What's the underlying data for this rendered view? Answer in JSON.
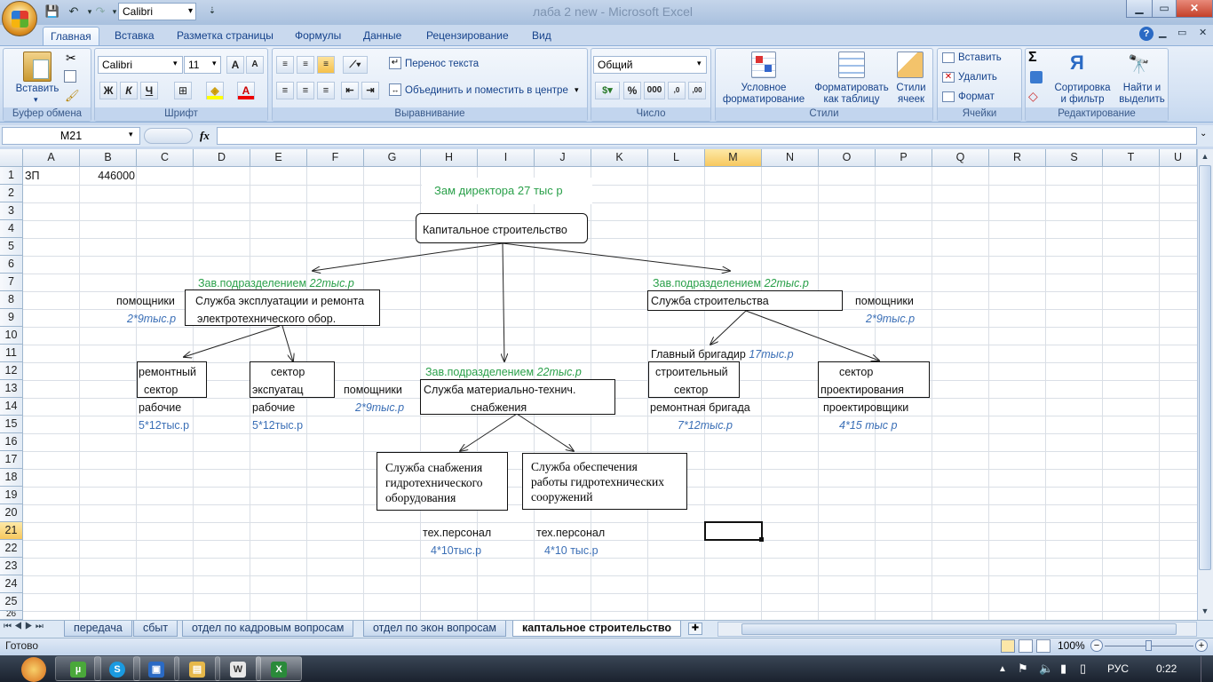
{
  "window": {
    "title": "лаба 2 new  -  Microsoft Excel"
  },
  "quick_access": {
    "font": "Calibri"
  },
  "ribbon_tabs": [
    "Главная",
    "Вставка",
    "Разметка страницы",
    "Формулы",
    "Данные",
    "Рецензирование",
    "Вид"
  ],
  "ribbon": {
    "clipboard": {
      "label": "Буфер обмена",
      "paste": "Вставить"
    },
    "font": {
      "label": "Шрифт",
      "name": "Calibri",
      "size": "11",
      "bold": "Ж",
      "italic": "К",
      "underline": "Ч"
    },
    "alignment": {
      "label": "Выравнивание",
      "wrap": "Перенос текста",
      "merge": "Объединить и поместить в центре"
    },
    "number": {
      "label": "Число",
      "format": "Общий",
      "percent": "%",
      "thousands": "000"
    },
    "styles": {
      "label": "Стили",
      "conditional": "Условное",
      "conditional2": "форматирование",
      "as_table": "Форматировать",
      "as_table2": "как таблицу",
      "cell_styles": "Стили",
      "cell_styles2": "ячеек"
    },
    "cells": {
      "label": "Ячейки",
      "insert": "Вставить",
      "delete": "Удалить",
      "format": "Формат"
    },
    "editing": {
      "label": "Редактирование",
      "sort": "Сортировка",
      "sort2": "и фильтр",
      "find": "Найти и",
      "find2": "выделить"
    }
  },
  "formula_bar": {
    "name_box": "M21",
    "fx": "fx",
    "value": ""
  },
  "columns": [
    "A",
    "B",
    "C",
    "D",
    "E",
    "F",
    "G",
    "H",
    "I",
    "J",
    "K",
    "L",
    "M",
    "N",
    "O",
    "P",
    "Q",
    "R",
    "S",
    "T",
    "U"
  ],
  "rows": [
    "1",
    "2",
    "3",
    "4",
    "5",
    "6",
    "7",
    "8",
    "9",
    "10",
    "11",
    "12",
    "13",
    "14",
    "15",
    "16",
    "17",
    "18",
    "19",
    "20",
    "21",
    "22",
    "23",
    "24",
    "25",
    "26"
  ],
  "cells": {
    "a1": "ЗП",
    "b1": "446000",
    "deputy": "Зам директора  27 тыс р",
    "capital": "Капитальное строительство",
    "head_left": "Зав.подразделением",
    "head_left_val": "22тыс.р",
    "head_right": "Зав.подразделением",
    "head_right_val": "22тыс.р",
    "head_mid": "Зав.подразделением",
    "head_mid_val": "22тыс.р",
    "assist_left": "помощники",
    "assist_left_val": "2*9тыс.р",
    "service_exploit_1": "Служба эксплуатации и ремонта",
    "service_exploit_2": "электротехнического обор.",
    "service_build": "Служба строительства",
    "assist_right": "помощники",
    "assist_right_val": "2*9тыс.р",
    "chief_foreman": "Главный бригадир",
    "chief_foreman_val": "17тыс.р",
    "repair_sector_1": "ремонтный",
    "repair_sector_2": "сектор",
    "exploit_sector_1": "сектор",
    "exploit_sector_2": "экспуатац",
    "assist_mid": "помощники",
    "assist_mid_val": "2*9тыс.р",
    "mts_1": "Служба материально-технич.",
    "mts_2": "снабжения",
    "build_sector_1": "строительный",
    "build_sector_2": "сектор",
    "design_sector_1": "сектор",
    "design_sector_2": "проектирования",
    "workers_1": "рабочие",
    "workers_1_val": "5*12тыс.р",
    "workers_2": "рабочие",
    "workers_2_val": "5*12тыс.р",
    "repair_brigade": "ремонтная бригада",
    "repair_brigade_val": "7*12тыс.р",
    "designers": "проектировщики",
    "designers_val": "4*15 тыс р",
    "hydro_supply_1": "Служба снабжения",
    "hydro_supply_2": "гидротехнического",
    "hydro_supply_3": "оборудования",
    "hydro_ops_1": "Служба обеспечения",
    "hydro_ops_2": "работы гидротехнических",
    "hydro_ops_3": "сооружений",
    "tech_1": "тех.персонал",
    "tech_1_val": "4*10тыс.р",
    "tech_2": "тех.персонал",
    "tech_2_val": "4*10 тыс.р"
  },
  "sheet_tabs": [
    "передача",
    "сбыт",
    "отдел по кадровым вопросам",
    "отдел по экон вопросам",
    "каптальное строительство"
  ],
  "status": {
    "ready": "Готово",
    "zoom": "100%"
  },
  "taskbar": {
    "lang": "РУС",
    "time": "0:22"
  }
}
